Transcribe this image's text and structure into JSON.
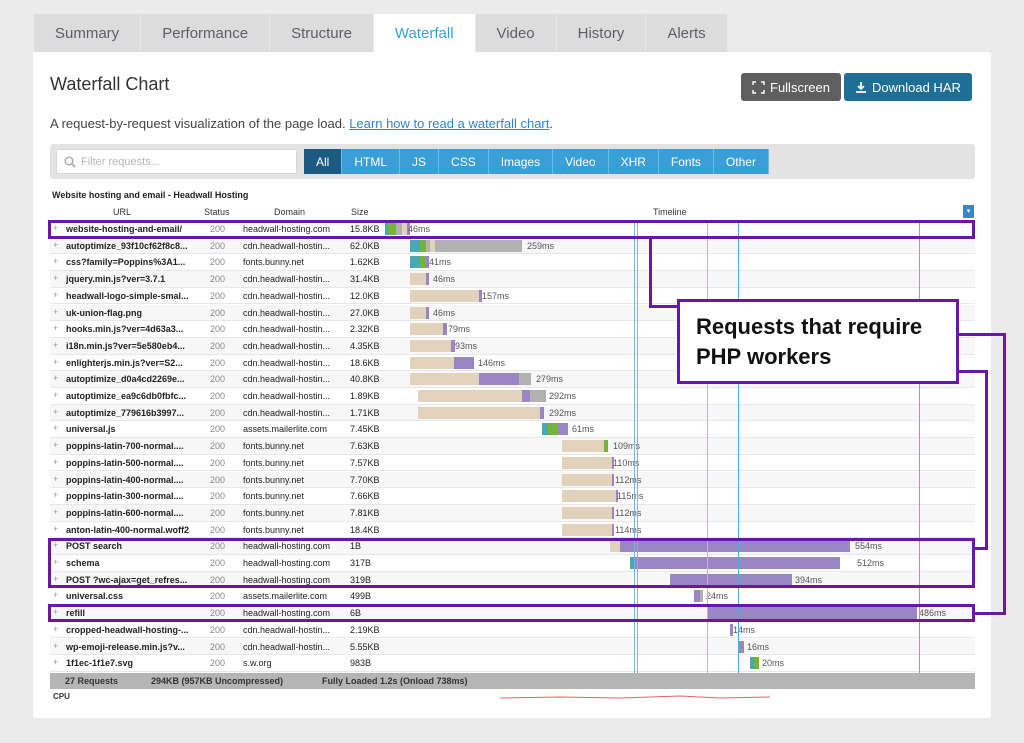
{
  "tabs": [
    "Summary",
    "Performance",
    "Structure",
    "Waterfall",
    "Video",
    "History",
    "Alerts"
  ],
  "active_tab": "Waterfall",
  "title": "Waterfall Chart",
  "buttons": {
    "fullscreen": "Fullscreen",
    "download": "Download HAR"
  },
  "description": {
    "text": "A request-by-request visualization of the page load.",
    "link": "Learn how to read a waterfall chart",
    "end": "."
  },
  "filter": {
    "placeholder": "Filter requests...",
    "chips": [
      "All",
      "HTML",
      "JS",
      "CSS",
      "Images",
      "Video",
      "XHR",
      "Fonts",
      "Other"
    ],
    "active": "All"
  },
  "waterfall": {
    "page_title": "Website hosting and email - Headwall Hosting",
    "headers": {
      "url": "URL",
      "status": "Status",
      "domain": "Domain",
      "size": "Size",
      "timeline": "Timeline"
    },
    "summary": {
      "requests": "27 Requests",
      "size": "294KB  (957KB Uncompressed)",
      "loaded": "Fully Loaded 1.2s  (Onload 738ms)"
    },
    "cpu_label": "CPU"
  },
  "rows": [
    {
      "url": "website-hosting-and-email/",
      "status": "200",
      "domain": "headwall-hosting.com",
      "size": "15.8KB",
      "ms": "46ms"
    },
    {
      "url": "autoptimize_93f10cf62f8c8...",
      "status": "200",
      "domain": "cdn.headwall-hostin...",
      "size": "62.0KB",
      "ms": "259ms"
    },
    {
      "url": "css?family=Poppins%3A1...",
      "status": "200",
      "domain": "fonts.bunny.net",
      "size": "1.62KB",
      "ms": "41ms"
    },
    {
      "url": "jquery.min.js?ver=3.7.1",
      "status": "200",
      "domain": "cdn.headwall-hostin...",
      "size": "31.4KB",
      "ms": "46ms"
    },
    {
      "url": "headwall-logo-simple-smal...",
      "status": "200",
      "domain": "cdn.headwall-hostin...",
      "size": "12.0KB",
      "ms": "157ms"
    },
    {
      "url": "uk-union-flag.png",
      "status": "200",
      "domain": "cdn.headwall-hostin...",
      "size": "27.0KB",
      "ms": "46ms"
    },
    {
      "url": "hooks.min.js?ver=4d63a3...",
      "status": "200",
      "domain": "cdn.headwall-hostin...",
      "size": "2.32KB",
      "ms": "79ms"
    },
    {
      "url": "i18n.min.js?ver=5e580eb4...",
      "status": "200",
      "domain": "cdn.headwall-hostin...",
      "size": "4.35KB",
      "ms": "93ms"
    },
    {
      "url": "enlighterjs.min.js?ver=S2...",
      "status": "200",
      "domain": "cdn.headwall-hostin...",
      "size": "18.6KB",
      "ms": "146ms"
    },
    {
      "url": "autoptimize_d0a4cd2269e...",
      "status": "200",
      "domain": "cdn.headwall-hostin...",
      "size": "40.8KB",
      "ms": "279ms"
    },
    {
      "url": "autoptimize_ea9c6db0fbfc...",
      "status": "200",
      "domain": "cdn.headwall-hostin...",
      "size": "1.89KB",
      "ms": "292ms"
    },
    {
      "url": "autoptimize_779616b3997...",
      "status": "200",
      "domain": "cdn.headwall-hostin...",
      "size": "1.71KB",
      "ms": "292ms"
    },
    {
      "url": "universal.js",
      "status": "200",
      "domain": "assets.mailerlite.com",
      "size": "7.45KB",
      "ms": "61ms"
    },
    {
      "url": "poppins-latin-700-normal....",
      "status": "200",
      "domain": "fonts.bunny.net",
      "size": "7.63KB",
      "ms": "109ms"
    },
    {
      "url": "poppins-latin-500-normal....",
      "status": "200",
      "domain": "fonts.bunny.net",
      "size": "7.57KB",
      "ms": "110ms"
    },
    {
      "url": "poppins-latin-400-normal....",
      "status": "200",
      "domain": "fonts.bunny.net",
      "size": "7.70KB",
      "ms": "112ms"
    },
    {
      "url": "poppins-latin-300-normal....",
      "status": "200",
      "domain": "fonts.bunny.net",
      "size": "7.66KB",
      "ms": "115ms"
    },
    {
      "url": "poppins-latin-600-normal....",
      "status": "200",
      "domain": "fonts.bunny.net",
      "size": "7.81KB",
      "ms": "112ms"
    },
    {
      "url": "anton-latin-400-normal.woff2",
      "status": "200",
      "domain": "fonts.bunny.net",
      "size": "18.4KB",
      "ms": "114ms"
    },
    {
      "url": "POST search",
      "status": "200",
      "domain": "headwall-hosting.com",
      "size": "1B",
      "ms": "554ms"
    },
    {
      "url": "schema",
      "status": "200",
      "domain": "headwall-hosting.com",
      "size": "317B",
      "ms": "512ms"
    },
    {
      "url": "POST ?wc-ajax=get_refres...",
      "status": "200",
      "domain": "headwall-hosting.com",
      "size": "319B",
      "ms": "394ms"
    },
    {
      "url": "universal.css",
      "status": "200",
      "domain": "assets.mailerlite.com",
      "size": "499B",
      "ms": "24ms"
    },
    {
      "url": "refill",
      "status": "200",
      "domain": "headwall-hosting.com",
      "size": "6B",
      "ms": "486ms"
    },
    {
      "url": "cropped-headwall-hosting-...",
      "status": "200",
      "domain": "cdn.headwall-hostin...",
      "size": "2.19KB",
      "ms": "14ms"
    },
    {
      "url": "wp-emoji-release.min.js?v...",
      "status": "200",
      "domain": "cdn.headwall-hostin...",
      "size": "5.55KB",
      "ms": "16ms"
    },
    {
      "url": "1f1ec-1f1e7.svg",
      "status": "200",
      "domain": "s.w.org",
      "size": "983B",
      "ms": "20ms"
    }
  ],
  "annotation": {
    "line1": "Requests that require",
    "line2": "PHP workers"
  },
  "colors": {
    "wait": "#e2d2bb",
    "receive": "#9b85c4",
    "dns": "#47a9b8",
    "connect": "#77b33c",
    "ssl": "#b1b1b1",
    "annotation": "#6a17a6"
  }
}
